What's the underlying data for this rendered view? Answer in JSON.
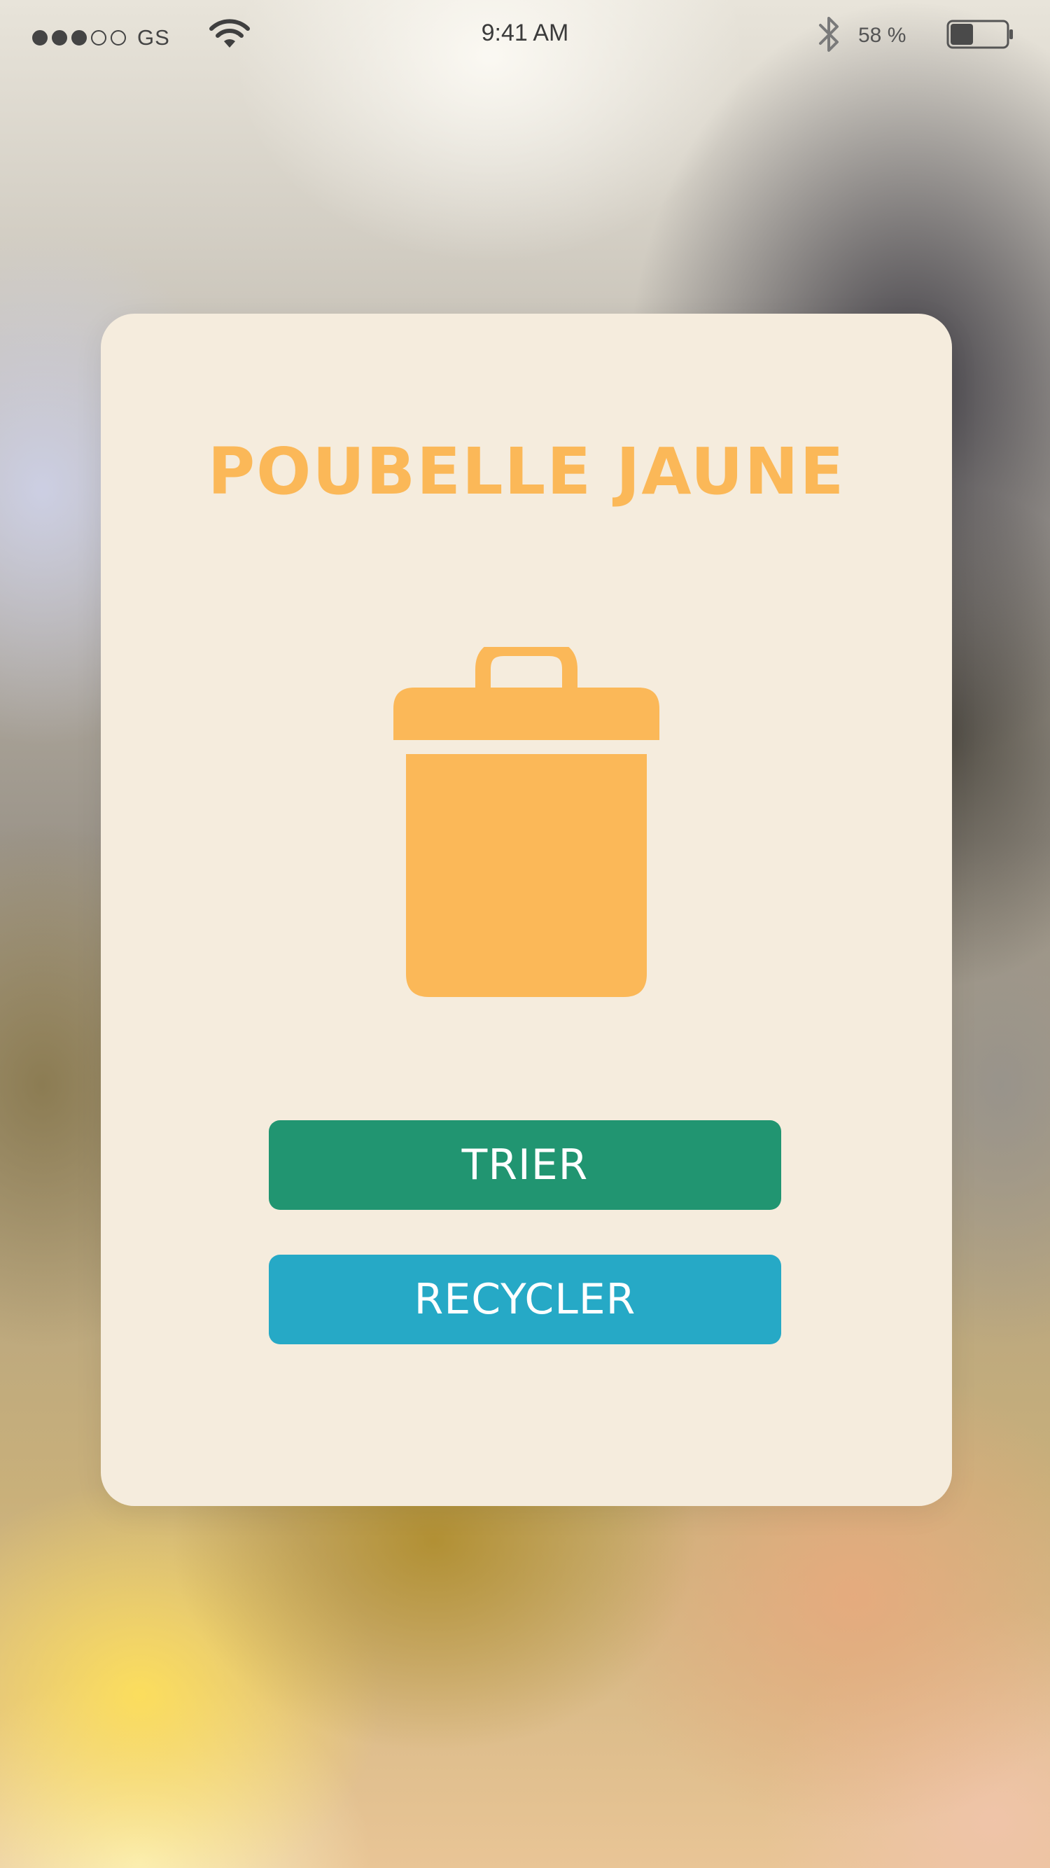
{
  "status_bar": {
    "signal_bars_filled": 3,
    "signal_bars_total": 5,
    "carrier": "GS",
    "time": "9:41 AM",
    "battery_percent_label": "58 %",
    "battery_level": 0.58,
    "icons": [
      "signal-dots",
      "wifi-icon",
      "bluetooth-icon",
      "battery-icon"
    ]
  },
  "card": {
    "title": "POUBELLE JAUNE",
    "icon": "trash-can-icon",
    "accent_color": "#fbb858",
    "background_color": "#f5ecdd"
  },
  "buttons": {
    "trier": {
      "label": "TRIER",
      "color": "#219571"
    },
    "recycler": {
      "label": "RECYCLER",
      "color": "#26a9c6"
    }
  }
}
